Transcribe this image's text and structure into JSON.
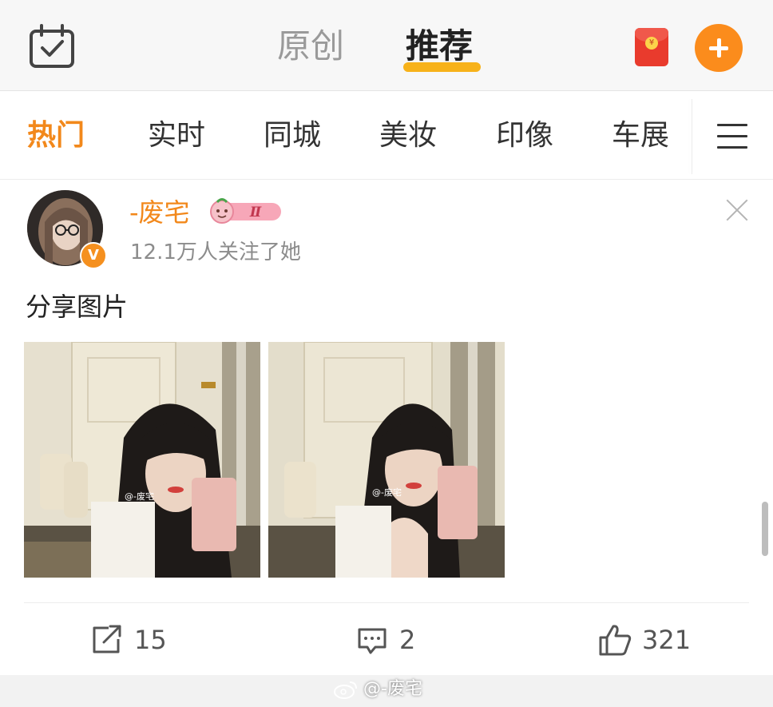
{
  "header": {
    "tabs": [
      {
        "label": "原创",
        "active": false
      },
      {
        "label": "推荐",
        "active": true
      }
    ],
    "left_icon": "calendar-check-icon",
    "red_packet_symbol": "¥",
    "accent_color": "#f7b21a",
    "plus_color": "#fb8c1c"
  },
  "categories": {
    "items": [
      "热门",
      "实时",
      "同城",
      "美妆",
      "印像",
      "车展"
    ],
    "active_index": 0,
    "menu_icon": "hamburger-menu-icon"
  },
  "post": {
    "username": "-废宅",
    "verified_symbol": "V",
    "badge_text": "Ⅱ",
    "followers_text": "12.1万人关注了她",
    "text": "分享图片",
    "image_watermark": "@-废宅",
    "actions": {
      "share_count": "15",
      "comment_count": "2",
      "like_count": "321"
    }
  },
  "watermark": "@-废宅",
  "colors": {
    "username_orange": "#f2881b",
    "active_category": "#f2881b",
    "verify_badge": "#f5901f"
  }
}
